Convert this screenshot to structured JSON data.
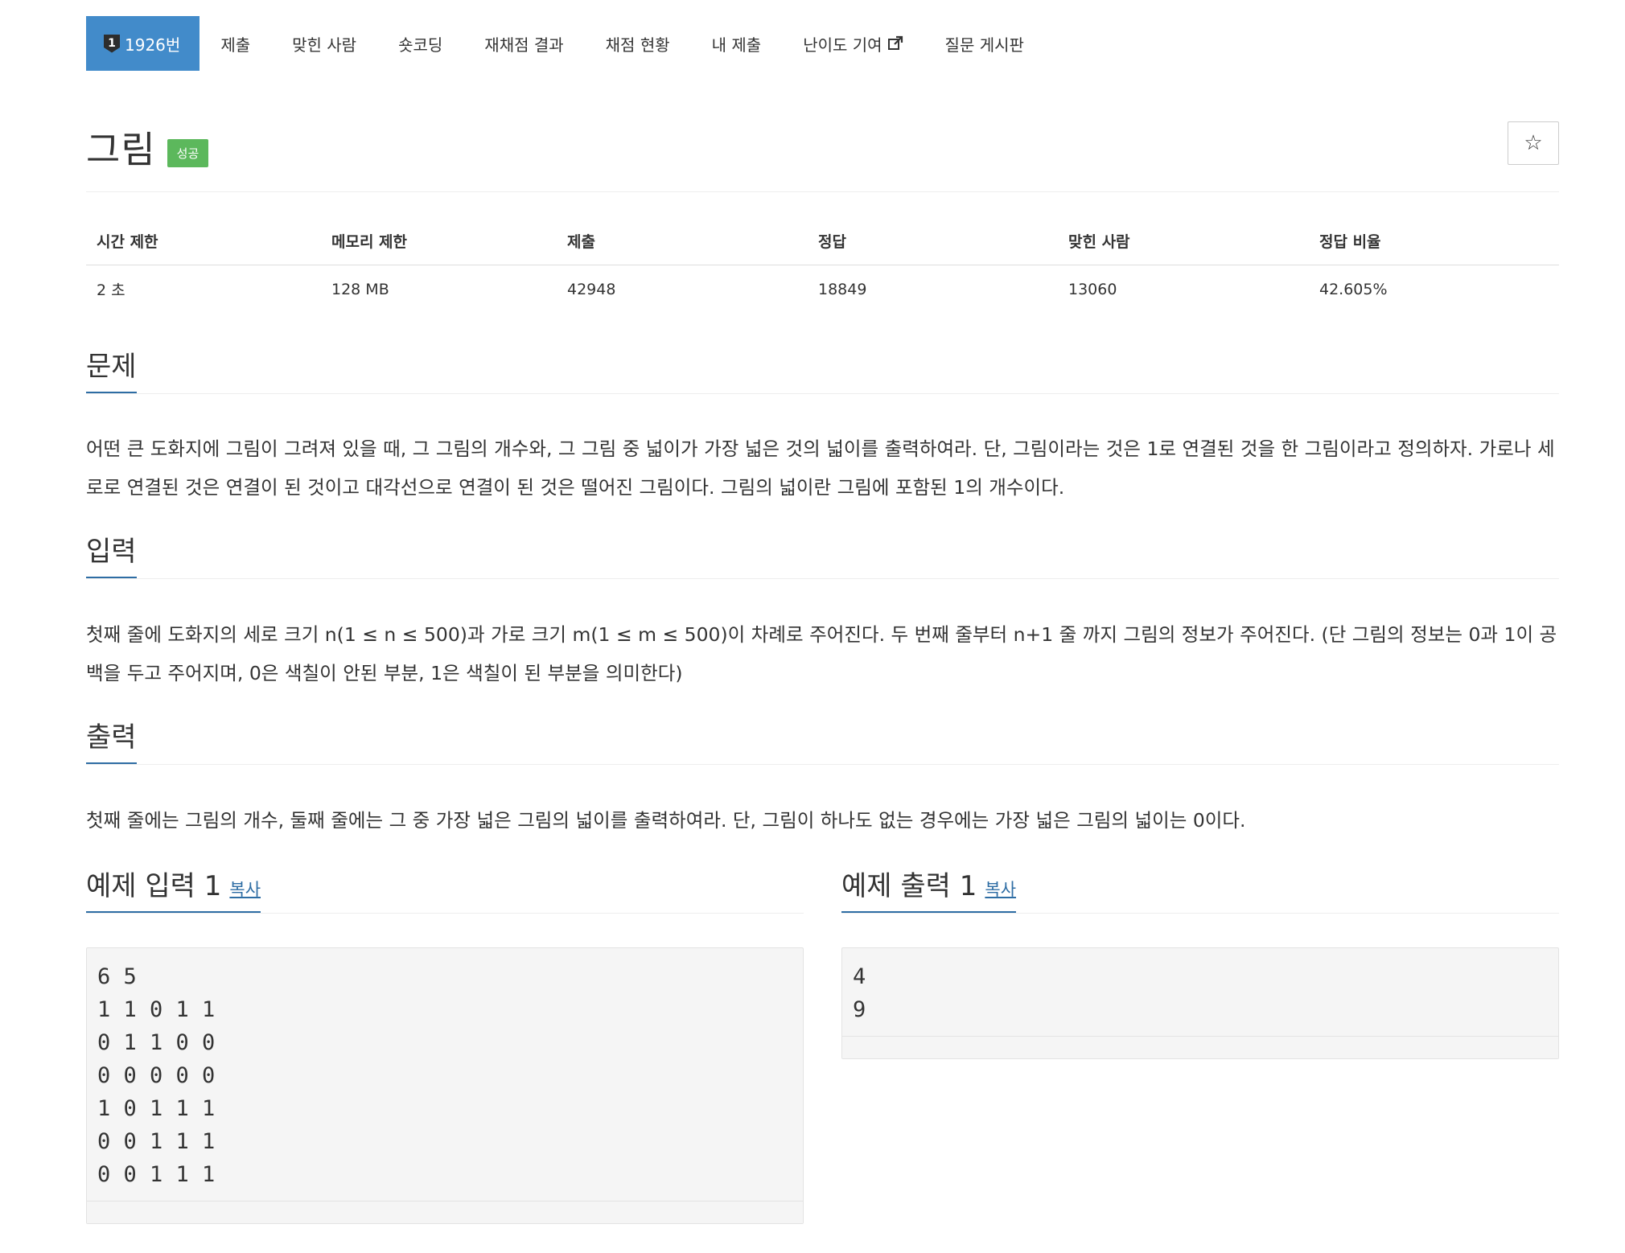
{
  "nav": {
    "problem_badge": "1",
    "items": [
      {
        "label": "1926번"
      },
      {
        "label": "제출"
      },
      {
        "label": "맞힌 사람"
      },
      {
        "label": "숏코딩"
      },
      {
        "label": "재채점 결과"
      },
      {
        "label": "채점 현황"
      },
      {
        "label": "내 제출"
      },
      {
        "label": "난이도 기여"
      },
      {
        "label": "질문 게시판"
      }
    ]
  },
  "problem": {
    "title": "그림",
    "status": "성공",
    "star": "☆"
  },
  "info": {
    "headers": [
      "시간 제한",
      "메모리 제한",
      "제출",
      "정답",
      "맞힌 사람",
      "정답 비율"
    ],
    "values": [
      "2 초",
      "128 MB",
      "42948",
      "18849",
      "13060",
      "42.605%"
    ]
  },
  "sections": {
    "description": {
      "title": "문제",
      "text": "어떤 큰 도화지에 그림이 그려져 있을 때, 그 그림의 개수와, 그 그림 중 넓이가 가장 넓은 것의 넓이를 출력하여라. 단, 그림이라는 것은 1로 연결된 것을 한 그림이라고 정의하자. 가로나 세로로 연결된 것은 연결이 된 것이고 대각선으로 연결이 된 것은 떨어진 그림이다. 그림의 넓이란 그림에 포함된 1의 개수이다."
    },
    "input": {
      "title": "입력",
      "text": "첫째 줄에 도화지의 세로 크기 n(1 ≤ n ≤ 500)과 가로 크기 m(1 ≤ m ≤ 500)이 차례로 주어진다. 두 번째 줄부터 n+1 줄 까지 그림의 정보가 주어진다. (단 그림의 정보는 0과 1이 공백을 두고 주어지며, 0은 색칠이 안된 부분, 1은 색칠이 된 부분을 의미한다)"
    },
    "output": {
      "title": "출력",
      "text": "첫째 줄에는 그림의 개수, 둘째 줄에는 그 중 가장 넓은 그림의 넓이를 출력하여라. 단, 그림이 하나도 없는 경우에는 가장 넓은 그림의 넓이는 0이다."
    }
  },
  "samples": {
    "input": {
      "title": "예제 입력 1",
      "copy_label": "복사",
      "content": "6 5\n1 1 0 1 1\n0 1 1 0 0\n0 0 0 0 0\n1 0 1 1 1\n0 0 1 1 1\n0 0 1 1 1"
    },
    "output": {
      "title": "예제 출력 1",
      "copy_label": "복사",
      "content": "4\n9"
    }
  },
  "colors": {
    "accent": "#428bca",
    "link": "#2e6da4",
    "success": "#5cb85c"
  },
  "icons": {
    "problem_badge": "shield-number-icon",
    "external_link": "external-link-icon",
    "star": "star-outline-icon"
  }
}
